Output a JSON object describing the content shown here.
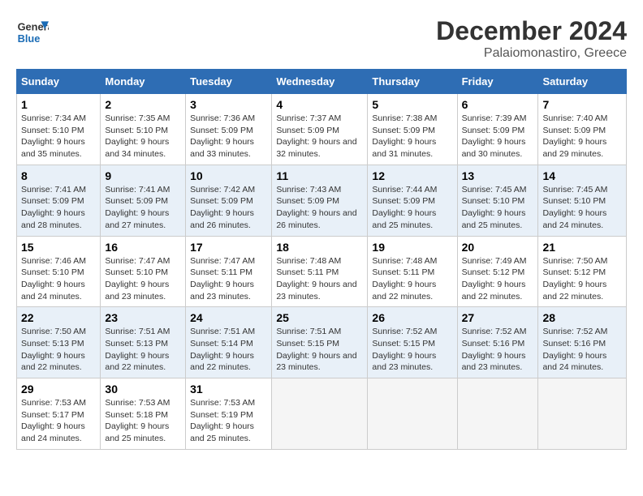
{
  "header": {
    "logo_line1": "General",
    "logo_line2": "Blue",
    "month_year": "December 2024",
    "location": "Palaiomonastiro, Greece"
  },
  "days_of_week": [
    "Sunday",
    "Monday",
    "Tuesday",
    "Wednesday",
    "Thursday",
    "Friday",
    "Saturday"
  ],
  "weeks": [
    [
      {
        "day": 1,
        "sunrise": "7:34 AM",
        "sunset": "5:10 PM",
        "daylight": "9 hours and 35 minutes."
      },
      {
        "day": 2,
        "sunrise": "7:35 AM",
        "sunset": "5:10 PM",
        "daylight": "9 hours and 34 minutes."
      },
      {
        "day": 3,
        "sunrise": "7:36 AM",
        "sunset": "5:09 PM",
        "daylight": "9 hours and 33 minutes."
      },
      {
        "day": 4,
        "sunrise": "7:37 AM",
        "sunset": "5:09 PM",
        "daylight": "9 hours and 32 minutes."
      },
      {
        "day": 5,
        "sunrise": "7:38 AM",
        "sunset": "5:09 PM",
        "daylight": "9 hours and 31 minutes."
      },
      {
        "day": 6,
        "sunrise": "7:39 AM",
        "sunset": "5:09 PM",
        "daylight": "9 hours and 30 minutes."
      },
      {
        "day": 7,
        "sunrise": "7:40 AM",
        "sunset": "5:09 PM",
        "daylight": "9 hours and 29 minutes."
      }
    ],
    [
      {
        "day": 8,
        "sunrise": "7:41 AM",
        "sunset": "5:09 PM",
        "daylight": "9 hours and 28 minutes."
      },
      {
        "day": 9,
        "sunrise": "7:41 AM",
        "sunset": "5:09 PM",
        "daylight": "9 hours and 27 minutes."
      },
      {
        "day": 10,
        "sunrise": "7:42 AM",
        "sunset": "5:09 PM",
        "daylight": "9 hours and 26 minutes."
      },
      {
        "day": 11,
        "sunrise": "7:43 AM",
        "sunset": "5:09 PM",
        "daylight": "9 hours and 26 minutes."
      },
      {
        "day": 12,
        "sunrise": "7:44 AM",
        "sunset": "5:09 PM",
        "daylight": "9 hours and 25 minutes."
      },
      {
        "day": 13,
        "sunrise": "7:45 AM",
        "sunset": "5:10 PM",
        "daylight": "9 hours and 25 minutes."
      },
      {
        "day": 14,
        "sunrise": "7:45 AM",
        "sunset": "5:10 PM",
        "daylight": "9 hours and 24 minutes."
      }
    ],
    [
      {
        "day": 15,
        "sunrise": "7:46 AM",
        "sunset": "5:10 PM",
        "daylight": "9 hours and 24 minutes."
      },
      {
        "day": 16,
        "sunrise": "7:47 AM",
        "sunset": "5:10 PM",
        "daylight": "9 hours and 23 minutes."
      },
      {
        "day": 17,
        "sunrise": "7:47 AM",
        "sunset": "5:11 PM",
        "daylight": "9 hours and 23 minutes."
      },
      {
        "day": 18,
        "sunrise": "7:48 AM",
        "sunset": "5:11 PM",
        "daylight": "9 hours and 23 minutes."
      },
      {
        "day": 19,
        "sunrise": "7:48 AM",
        "sunset": "5:11 PM",
        "daylight": "9 hours and 22 minutes."
      },
      {
        "day": 20,
        "sunrise": "7:49 AM",
        "sunset": "5:12 PM",
        "daylight": "9 hours and 22 minutes."
      },
      {
        "day": 21,
        "sunrise": "7:50 AM",
        "sunset": "5:12 PM",
        "daylight": "9 hours and 22 minutes."
      }
    ],
    [
      {
        "day": 22,
        "sunrise": "7:50 AM",
        "sunset": "5:13 PM",
        "daylight": "9 hours and 22 minutes."
      },
      {
        "day": 23,
        "sunrise": "7:51 AM",
        "sunset": "5:13 PM",
        "daylight": "9 hours and 22 minutes."
      },
      {
        "day": 24,
        "sunrise": "7:51 AM",
        "sunset": "5:14 PM",
        "daylight": "9 hours and 22 minutes."
      },
      {
        "day": 25,
        "sunrise": "7:51 AM",
        "sunset": "5:15 PM",
        "daylight": "9 hours and 23 minutes."
      },
      {
        "day": 26,
        "sunrise": "7:52 AM",
        "sunset": "5:15 PM",
        "daylight": "9 hours and 23 minutes."
      },
      {
        "day": 27,
        "sunrise": "7:52 AM",
        "sunset": "5:16 PM",
        "daylight": "9 hours and 23 minutes."
      },
      {
        "day": 28,
        "sunrise": "7:52 AM",
        "sunset": "5:16 PM",
        "daylight": "9 hours and 24 minutes."
      }
    ],
    [
      {
        "day": 29,
        "sunrise": "7:53 AM",
        "sunset": "5:17 PM",
        "daylight": "9 hours and 24 minutes."
      },
      {
        "day": 30,
        "sunrise": "7:53 AM",
        "sunset": "5:18 PM",
        "daylight": "9 hours and 25 minutes."
      },
      {
        "day": 31,
        "sunrise": "7:53 AM",
        "sunset": "5:19 PM",
        "daylight": "9 hours and 25 minutes."
      },
      null,
      null,
      null,
      null
    ]
  ]
}
